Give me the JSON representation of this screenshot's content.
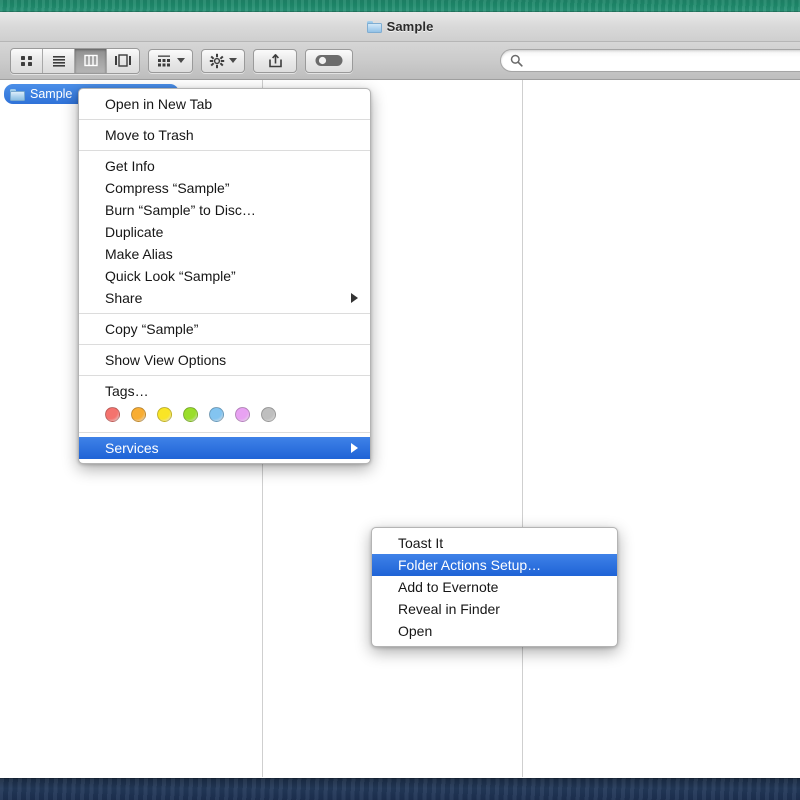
{
  "desktop": {
    "top_color": "#1d8a6b",
    "bottom_color": "#22395a"
  },
  "window": {
    "title": "Sample",
    "title_icon": "folder-icon"
  },
  "toolbar": {
    "view_buttons": [
      {
        "name": "icon-view",
        "icon": "grid-icon",
        "active": false
      },
      {
        "name": "list-view",
        "icon": "list-icon",
        "active": false
      },
      {
        "name": "column-view",
        "icon": "columns-icon",
        "active": true
      },
      {
        "name": "cover-flow-view",
        "icon": "coverflow-icon",
        "active": false
      }
    ],
    "arrange_button": {
      "name": "arrange-button",
      "icon": "arrange-icon"
    },
    "action_button": {
      "name": "action-button",
      "icon": "gear-icon"
    },
    "share_button": {
      "name": "share-button",
      "icon": "share-icon"
    },
    "tags_button": {
      "name": "tag-toggle-button",
      "icon": "tag-pill-icon"
    },
    "search": {
      "placeholder": "",
      "value": "",
      "icon": "search-icon"
    }
  },
  "columns": {
    "divider_x": [
      262,
      522
    ],
    "rows": [
      {
        "label": "Sample",
        "icon": "folder-icon",
        "selected": true
      }
    ]
  },
  "context_menu": {
    "groups": [
      {
        "items": [
          {
            "label": "Open in New Tab",
            "submenu": false,
            "highlight": false
          }
        ]
      },
      {
        "items": [
          {
            "label": "Move to Trash",
            "submenu": false,
            "highlight": false
          }
        ]
      },
      {
        "items": [
          {
            "label": "Get Info",
            "submenu": false,
            "highlight": false
          },
          {
            "label": "Compress “Sample”",
            "submenu": false,
            "highlight": false
          },
          {
            "label": "Burn “Sample” to Disc…",
            "submenu": false,
            "highlight": false
          },
          {
            "label": "Duplicate",
            "submenu": false,
            "highlight": false
          },
          {
            "label": "Make Alias",
            "submenu": false,
            "highlight": false
          },
          {
            "label": "Quick Look “Sample”",
            "submenu": false,
            "highlight": false
          },
          {
            "label": "Share",
            "submenu": true,
            "highlight": false
          }
        ]
      },
      {
        "items": [
          {
            "label": "Copy “Sample”",
            "submenu": false,
            "highlight": false
          }
        ]
      },
      {
        "items": [
          {
            "label": "Show View Options",
            "submenu": false,
            "highlight": false
          }
        ]
      },
      {
        "items": [
          {
            "label": "Tags…",
            "submenu": false,
            "highlight": false
          }
        ],
        "tags": [
          {
            "name": "tag-red",
            "color": "#f4736e"
          },
          {
            "name": "tag-orange",
            "color": "#f8ad33"
          },
          {
            "name": "tag-yellow",
            "color": "#f9e526"
          },
          {
            "name": "tag-green",
            "color": "#9ade2b"
          },
          {
            "name": "tag-blue",
            "color": "#83c4f0"
          },
          {
            "name": "tag-purple",
            "color": "#e8a2f2"
          },
          {
            "name": "tag-gray",
            "color": "#bfbfbf"
          }
        ]
      },
      {
        "items": [
          {
            "label": "Services",
            "submenu": true,
            "highlight": true
          }
        ]
      }
    ]
  },
  "services_submenu": {
    "items": [
      {
        "label": "Toast It",
        "highlight": false
      },
      {
        "label": "Folder Actions Setup…",
        "highlight": true
      },
      {
        "label": "Add to Evernote",
        "highlight": false
      },
      {
        "label": "Reveal in Finder",
        "highlight": false
      },
      {
        "label": "Open",
        "highlight": false
      }
    ]
  }
}
